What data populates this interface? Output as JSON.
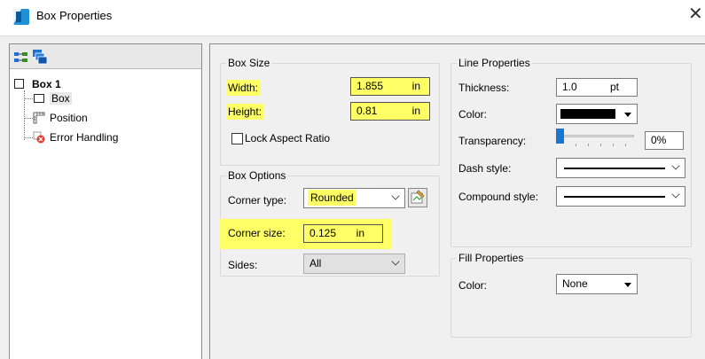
{
  "window": {
    "title": "Box Properties",
    "close_glyph": "✕"
  },
  "tree": {
    "root_label": "Box 1",
    "items": [
      {
        "label": "Box",
        "icon": "box-outline-icon",
        "selected": true
      },
      {
        "label": "Position",
        "icon": "position-ruler-icon",
        "selected": false
      },
      {
        "label": "Error Handling",
        "icon": "error-icon",
        "selected": false
      }
    ]
  },
  "box_size": {
    "title": "Box Size",
    "width_label": "Width:",
    "width_value": "1.855",
    "width_unit": "in",
    "height_label": "Height:",
    "height_value": "0.81",
    "height_unit": "in",
    "lock_label": "Lock Aspect Ratio"
  },
  "box_options": {
    "title": "Box Options",
    "corner_type_label": "Corner type:",
    "corner_type_value": "Rounded",
    "corner_size_label": "Corner size:",
    "corner_size_value": "0.125",
    "corner_size_unit": "in",
    "sides_label": "Sides:",
    "sides_value": "All"
  },
  "line_properties": {
    "title": "Line Properties",
    "thickness_label": "Thickness:",
    "thickness_value": "1.0",
    "thickness_unit": "pt",
    "color_label": "Color:",
    "color_value": "#000000",
    "transparency_label": "Transparency:",
    "transparency_value": "0%",
    "dash_label": "Dash style:",
    "compound_label": "Compound style:"
  },
  "fill_properties": {
    "title": "Fill Properties",
    "color_label": "Color:",
    "color_value": "None"
  },
  "colors": {
    "highlight": "#ffff66",
    "accent": "#1976d2"
  }
}
